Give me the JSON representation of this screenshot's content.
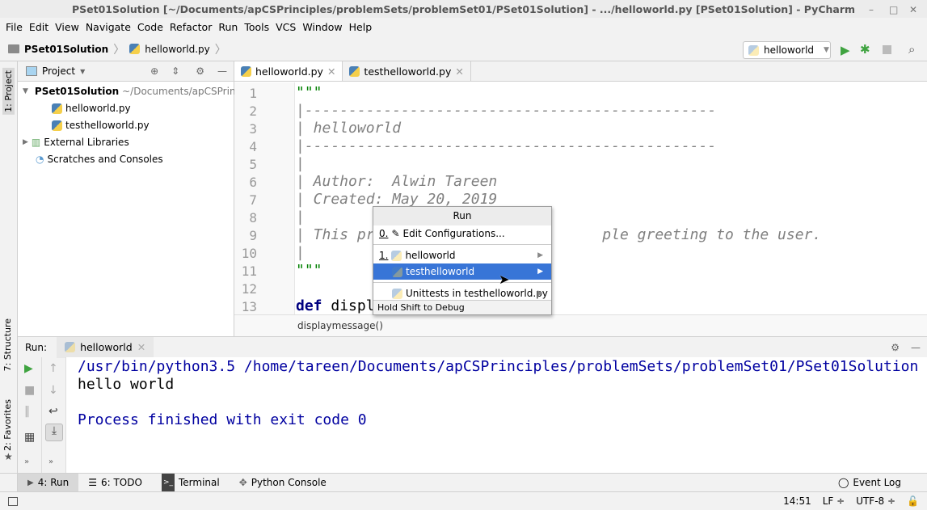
{
  "window": {
    "title": "PSet01Solution [~/Documents/apCSPrinciples/problemSets/problemSet01/PSet01Solution] - .../helloworld.py [PSet01Solution] - PyCharm",
    "minimize": "–",
    "maximize": "□",
    "close": "✕"
  },
  "menu": [
    "File",
    "Edit",
    "View",
    "Navigate",
    "Code",
    "Refactor",
    "Run",
    "Tools",
    "VCS",
    "Window",
    "Help"
  ],
  "navbar": {
    "project": "PSet01Solution",
    "file": "helloworld.py",
    "run_config": "helloworld"
  },
  "left_strip": {
    "project": "1: Project",
    "structure": "7: Structure",
    "favorites": "2: Favorites"
  },
  "project_panel": {
    "title": "Project",
    "root": "PSet01Solution",
    "root_path": "~/Documents/apCSPrin",
    "files": [
      "helloworld.py",
      "testhelloworld.py"
    ],
    "external": "External Libraries",
    "scratches": "Scratches and Consoles"
  },
  "editor": {
    "tabs": [
      "helloworld.py",
      "testhelloworld.py"
    ],
    "lines": [
      "\"\"\"",
      "|-----------------------------------------------",
      "| helloworld",
      "|-----------------------------------------------",
      "|",
      "| Author:  Alwin Tareen",
      "| Created: May 20, 2019",
      "|",
      "| This pr                          ple greeting to the user.",
      "|",
      "\"\"\"",
      "",
      "def displ"
    ],
    "breadcrumb": "displaymessage()"
  },
  "run_popup": {
    "title": "Run",
    "edit_key": "0.",
    "edit": "Edit Configurations...",
    "item1_key": "1.",
    "item1": "helloworld",
    "item2": "testhelloworld",
    "item3": "Unittests in testhelloworld.py",
    "footer": "Hold Shift to Debug"
  },
  "run_panel": {
    "label": "Run:",
    "tab": "helloworld",
    "output": [
      "/usr/bin/python3.5 /home/tareen/Documents/apCSPrinciples/problemSets/problemSet01/PSet01Solution",
      "hello world",
      "",
      "Process finished with exit code 0"
    ]
  },
  "bottom_tools": [
    "4: Run",
    "6: TODO",
    "Terminal",
    "Python Console"
  ],
  "event_log": "Event Log",
  "status": {
    "position": "14:51",
    "line_sep": "LF ÷",
    "encoding": "UTF-8 ÷"
  }
}
